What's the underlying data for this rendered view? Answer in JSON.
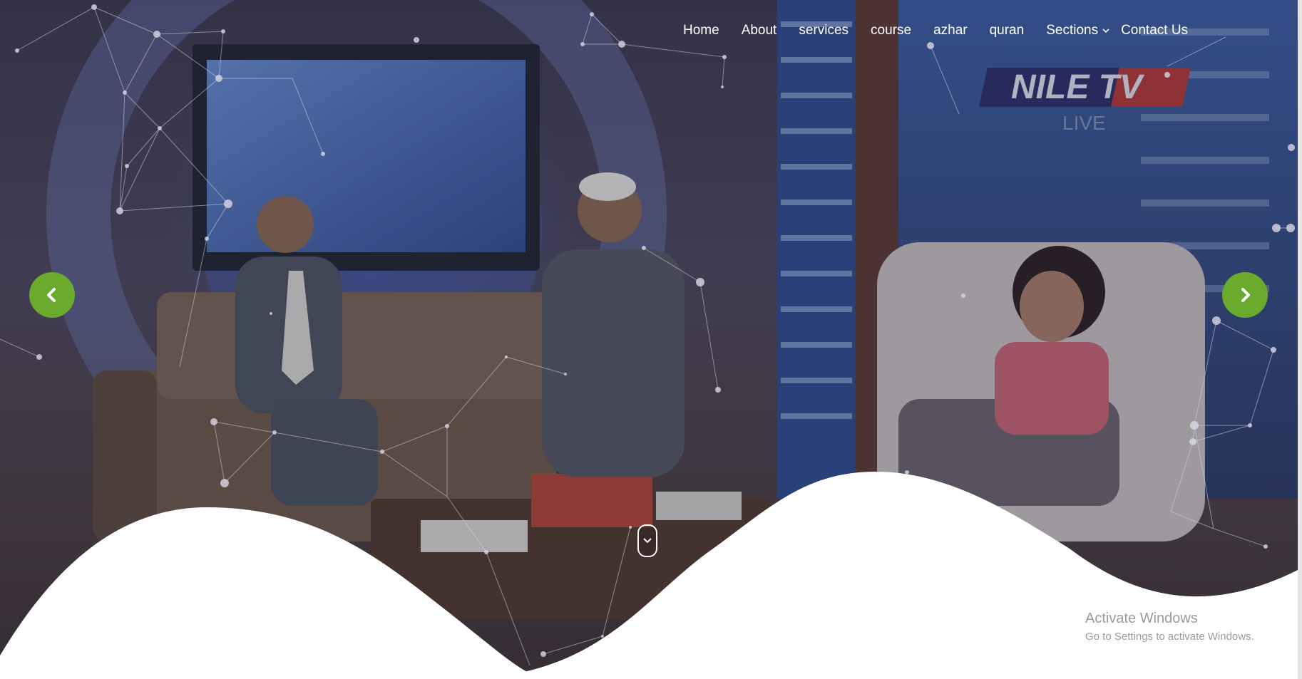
{
  "nav": {
    "items": [
      {
        "label": "Home"
      },
      {
        "label": "About"
      },
      {
        "label": "services"
      },
      {
        "label": "course"
      },
      {
        "label": "azhar"
      },
      {
        "label": "quran"
      },
      {
        "label": "Sections"
      },
      {
        "label": "Contact Us"
      }
    ]
  },
  "hero": {
    "banner_text": "NILE TV",
    "banner_sub": "LIVE"
  },
  "watermark": {
    "title": "Activate Windows",
    "subtitle": "Go to Settings to activate Windows."
  },
  "colors": {
    "accent": "#6aab2e",
    "nav_text": "#ffffff",
    "wave": "#ffffff"
  },
  "icons": {
    "prev": "chevron-left-icon",
    "next": "chevron-right-icon",
    "scroll": "chevron-down-icon",
    "dropdown": "chevron-down-icon"
  }
}
